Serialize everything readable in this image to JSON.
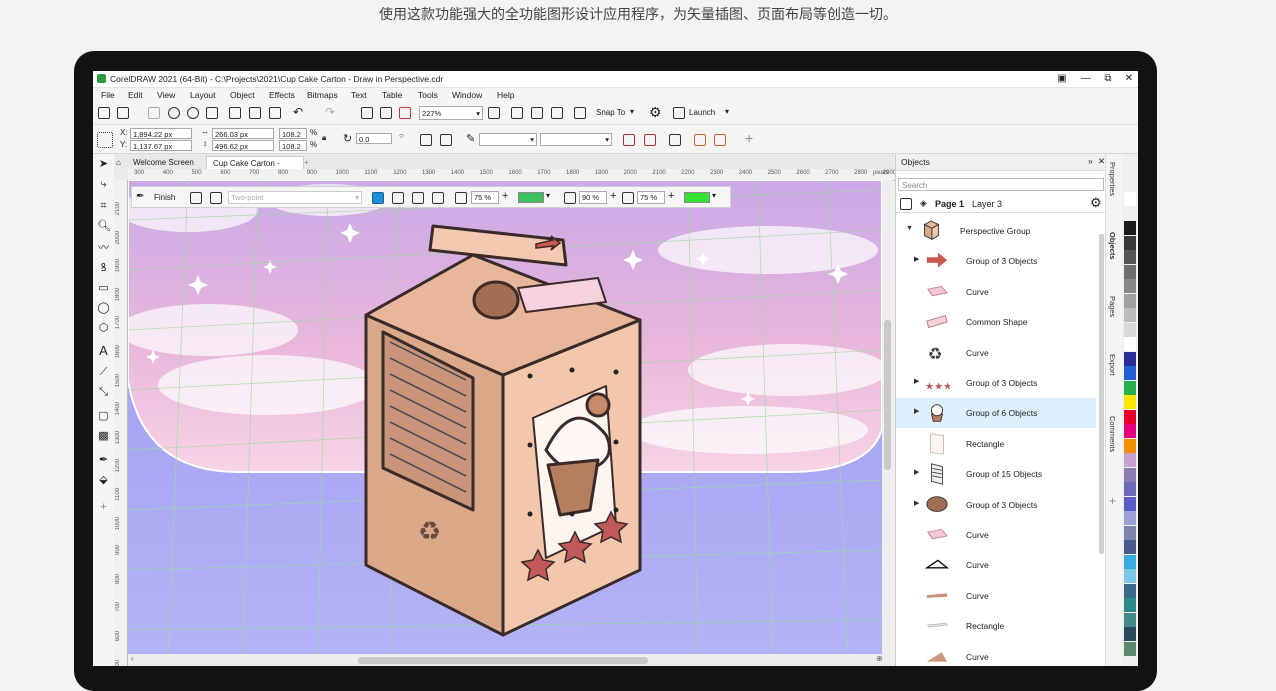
{
  "caption": "使用这款功能强大的全功能图形设计应用程序，为矢量插图、页面布局等创造一切。",
  "window": {
    "title": "CorelDRAW 2021 (64-Bit) - C:\\Projects\\2021\\Cup Cake Carton - Draw in Perspective.cdr"
  },
  "menu": [
    "File",
    "Edit",
    "View",
    "Layout",
    "Object",
    "Effects",
    "Bitmaps",
    "Text",
    "Table",
    "Tools",
    "Window",
    "Help"
  ],
  "toolbar": {
    "zoom": "227%",
    "snap_to": "Snap To",
    "launch": "Launch"
  },
  "property_bar": {
    "x": "1,894.22 px",
    "y": "1,137.67 px",
    "width": "266.03 px",
    "height": "496.62 px",
    "scale_x": "108.2",
    "scale_y": "108.2",
    "percent": "%",
    "rotation": "0.0",
    "x_label": "X:",
    "y_label": "Y:"
  },
  "tabs": [
    "Welcome Screen",
    "Cup Cake Carton - Dra..."
  ],
  "ruler": {
    "h_ticks": [
      "300",
      "400",
      "500",
      "600",
      "700",
      "800",
      "900",
      "1000",
      "1100",
      "1200",
      "1300",
      "1400",
      "1500",
      "1600",
      "1700",
      "1800",
      "1900",
      "2000",
      "2100",
      "2200",
      "2300",
      "2400",
      "2500",
      "2600",
      "2700",
      "2800",
      "2900"
    ],
    "unit": "pixels",
    "v_ticks": [
      "2100",
      "2000",
      "1900",
      "1800",
      "1700",
      "1600",
      "1500",
      "1400",
      "1300",
      "1200",
      "1100",
      "1000",
      "900",
      "800",
      "700",
      "600",
      "500"
    ]
  },
  "perspective_bar": {
    "finish": "Finish",
    "mode": "Two-point",
    "opacity1": "75 %",
    "opacity2": "90 %",
    "opacity3": "75 %",
    "color1": "#3cc060",
    "color2": "#33e033"
  },
  "objects_panel": {
    "title": "Objects",
    "search_placeholder": "Search",
    "page": "Page 1",
    "layer": "Layer 3",
    "items": [
      {
        "label": "Perspective Group",
        "expanded": true,
        "thumb": "carton"
      },
      {
        "label": "Group of 3 Objects",
        "expandable": true,
        "thumb": "arrow"
      },
      {
        "label": "Curve",
        "thumb": "pink-quad"
      },
      {
        "label": "Common Shape",
        "thumb": "banner"
      },
      {
        "label": "Curve",
        "thumb": "recycle"
      },
      {
        "label": "Group of 3 Objects",
        "expandable": true,
        "thumb": "stars"
      },
      {
        "label": "Group of 6 Objects",
        "expandable": true,
        "thumb": "cupcake",
        "selected": true
      },
      {
        "label": "Rectangle",
        "thumb": "rect"
      },
      {
        "label": "Group of 15 Objects",
        "expandable": true,
        "thumb": "lines"
      },
      {
        "label": "Group of 3 Objects",
        "expandable": true,
        "thumb": "cookie"
      },
      {
        "label": "Curve",
        "thumb": "pink-quad"
      },
      {
        "label": "Curve",
        "thumb": "triangle"
      },
      {
        "label": "Curve",
        "thumb": "brown-strip"
      },
      {
        "label": "Rectangle",
        "thumb": "thin-rect"
      },
      {
        "label": "Curve",
        "thumb": "brown-tri"
      }
    ]
  },
  "side_tabs": [
    "Properties",
    "Objects",
    "Pages",
    "Export",
    "Comments"
  ],
  "palette": [
    "#ffffff",
    "#f0f0f0",
    "#1a1a1a",
    "#3a3a3a",
    "#555",
    "#6e6e6e",
    "#888",
    "#a0a0a0",
    "#bcbcbc",
    "#d8d8d8",
    "#ffffff",
    "#2d2d9a",
    "#1f5fd1",
    "#26b14c",
    "#ffe600",
    "#e8002a",
    "#e6007e",
    "#f29100",
    "#c8a0d0",
    "#8a7bb0",
    "#6a6ab8",
    "#5a5ac8",
    "#9aa0d8",
    "#7c86a8",
    "#4a5a8a",
    "#39adde",
    "#7ec7e8",
    "#3a6a8a",
    "#2a8a8a",
    "#448888",
    "#2a4a5a",
    "#5a8a6a"
  ]
}
